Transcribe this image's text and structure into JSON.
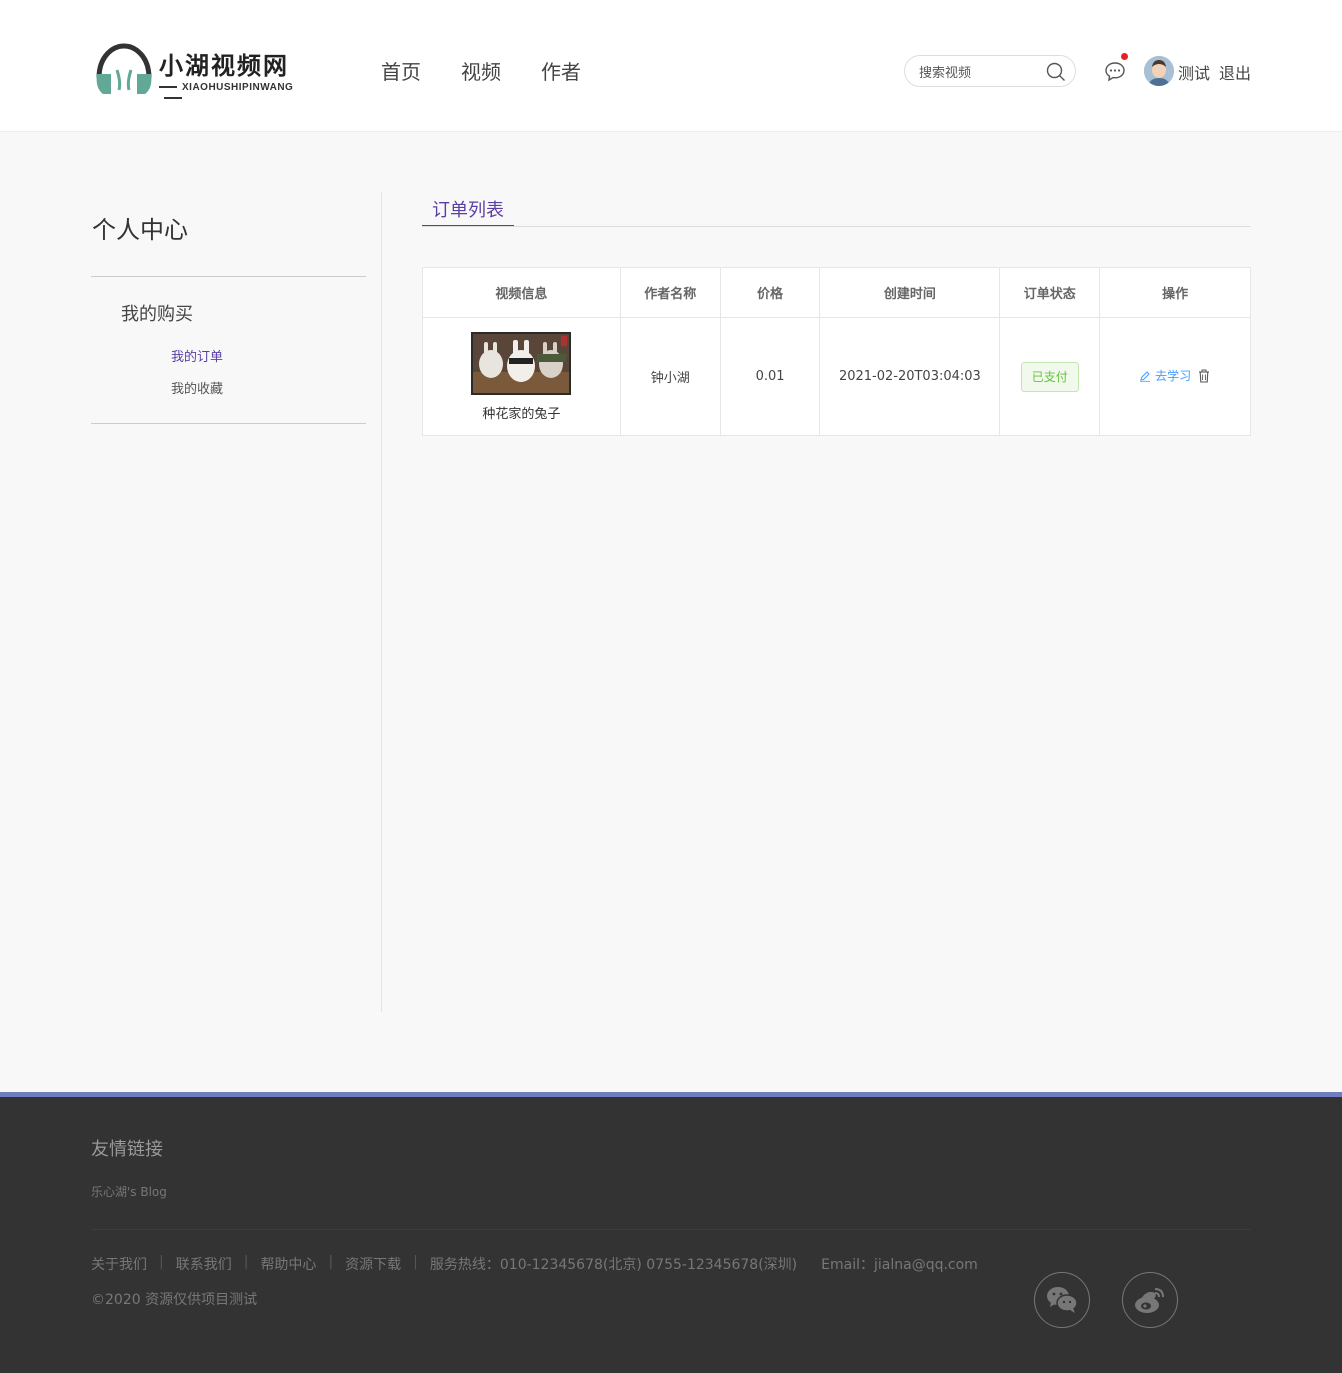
{
  "header": {
    "logo_cn": "小湖视频网",
    "logo_en": "XIAOHUSHIPINWANG",
    "nav": [
      "首页",
      "视频",
      "作者"
    ],
    "search_placeholder": "搜索视频",
    "user_name": "测试",
    "logout": "退出"
  },
  "sidebar": {
    "title": "个人中心",
    "group": "我的购买",
    "items": [
      {
        "label": "我的订单",
        "active": true
      },
      {
        "label": "我的收藏",
        "active": false
      }
    ]
  },
  "main": {
    "tab": "订单列表",
    "table": {
      "headers": [
        "视频信息",
        "作者名称",
        "价格",
        "创建时间",
        "订单状态",
        "操作"
      ],
      "rows": [
        {
          "video_title": "种花家的兔子",
          "author": "钟小湖",
          "price": "0.01",
          "created": "2021-02-20T03:04:03",
          "status": "已支付",
          "action": "去学习"
        }
      ]
    }
  },
  "footer": {
    "title": "友情链接",
    "friend_link": "乐心湖's Blog",
    "links": [
      "关于我们",
      "联系我们",
      "帮助中心",
      "资源下载"
    ],
    "hotline": "服务热线：010-12345678(北京) 0755-12345678(深圳)",
    "email": "Email：jialna@qq.com",
    "copyright": "©2020 资源仅供项目测试"
  },
  "colors": {
    "accent": "#5b3ea5",
    "link": "#409eff",
    "success": "#67c23a",
    "footer_bg": "#333333",
    "footer_bar": "#6f7fbd"
  },
  "icons": [
    "headphones-logo-icon",
    "search-icon",
    "message-icon",
    "avatar",
    "edit-icon",
    "trash-icon",
    "wechat-icon",
    "weibo-icon"
  ]
}
